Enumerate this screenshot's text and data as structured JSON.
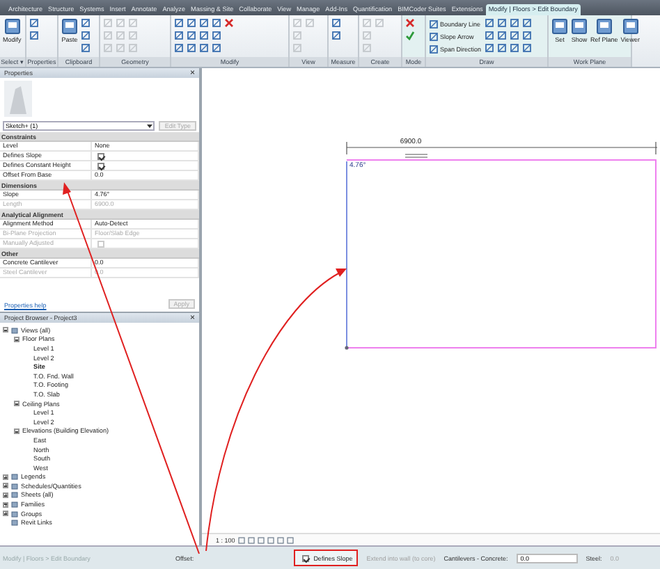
{
  "ribbon_tabs": [
    {
      "label": "Architecture",
      "selected": false
    },
    {
      "label": "Structure",
      "selected": false
    },
    {
      "label": "Systems",
      "selected": false
    },
    {
      "label": "Insert",
      "selected": false
    },
    {
      "label": "Annotate",
      "selected": false
    },
    {
      "label": "Analyze",
      "selected": false
    },
    {
      "label": "Massing & Site",
      "selected": false
    },
    {
      "label": "Collaborate",
      "selected": false
    },
    {
      "label": "View",
      "selected": false
    },
    {
      "label": "Manage",
      "selected": false
    },
    {
      "label": "Add-Ins",
      "selected": false
    },
    {
      "label": "Quantification",
      "selected": false
    },
    {
      "label": "BIMCoder Suites",
      "selected": false
    },
    {
      "label": "Extensions",
      "selected": false
    },
    {
      "label": "Modify | Floors > Edit Boundary",
      "selected": true
    }
  ],
  "ribbon_panels": [
    {
      "label": "Select ▾",
      "items": [
        {
          "kind": "large",
          "label": "Modify"
        }
      ]
    },
    {
      "label": "Properties",
      "items": [
        {
          "kind": "icon"
        },
        {
          "kind": "icon"
        }
      ]
    },
    {
      "label": "Clipboard",
      "items": [
        {
          "kind": "large",
          "label": "Paste"
        },
        {
          "kind": "icon"
        },
        {
          "kind": "icon"
        },
        {
          "kind": "icon"
        }
      ]
    },
    {
      "label": "Geometry",
      "items": [
        {
          "kind": "muted"
        },
        {
          "kind": "muted"
        },
        {
          "kind": "muted"
        },
        {
          "kind": "muted"
        },
        {
          "kind": "muted"
        },
        {
          "kind": "muted"
        },
        {
          "kind": "muted"
        },
        {
          "kind": "muted"
        },
        {
          "kind": "muted"
        }
      ]
    },
    {
      "label": "Modify",
      "items": [
        {
          "kind": "icon"
        },
        {
          "kind": "icon"
        },
        {
          "kind": "icon"
        },
        {
          "kind": "icon"
        },
        {
          "kind": "icon"
        },
        {
          "kind": "icon"
        },
        {
          "kind": "icon"
        },
        {
          "kind": "icon"
        },
        {
          "kind": "icon"
        },
        {
          "kind": "icon"
        },
        {
          "kind": "icon"
        },
        {
          "kind": "icon"
        },
        {
          "kind": "cancel"
        }
      ]
    },
    {
      "label": "View",
      "items": [
        {
          "kind": "muted"
        },
        {
          "kind": "muted"
        },
        {
          "kind": "muted"
        },
        {
          "kind": "muted"
        }
      ]
    },
    {
      "label": "Measure",
      "items": [
        {
          "kind": "icon"
        },
        {
          "kind": "icon"
        }
      ]
    },
    {
      "label": "Create",
      "items": [
        {
          "kind": "muted"
        },
        {
          "kind": "muted"
        },
        {
          "kind": "muted"
        },
        {
          "kind": "muted"
        }
      ]
    },
    {
      "label": "Mode",
      "items": [
        {
          "kind": "cancel"
        },
        {
          "kind": "finish"
        }
      ]
    },
    {
      "label": "Draw",
      "items": [
        {
          "kind": "small",
          "label": "Boundary Line"
        },
        {
          "kind": "small",
          "label": "Slope Arrow"
        },
        {
          "kind": "small",
          "label": "Span Direction"
        },
        {
          "kind": "icon"
        },
        {
          "kind": "icon"
        },
        {
          "kind": "icon"
        },
        {
          "kind": "icon"
        },
        {
          "kind": "icon"
        },
        {
          "kind": "icon"
        },
        {
          "kind": "icon"
        },
        {
          "kind": "icon"
        },
        {
          "kind": "icon"
        },
        {
          "kind": "icon"
        },
        {
          "kind": "icon"
        },
        {
          "kind": "icon"
        }
      ]
    },
    {
      "label": "Work Plane",
      "items": [
        {
          "kind": "large",
          "label": "Set"
        },
        {
          "kind": "large",
          "label": "Show"
        },
        {
          "kind": "large",
          "label": "Ref Plane"
        },
        {
          "kind": "large",
          "label": "Viewer"
        }
      ]
    }
  ],
  "properties": {
    "title": "Properties",
    "close": "×",
    "type_selector": "Sketch+ (1)",
    "edit_type": "Edit Type",
    "groups": [
      {
        "name": "Constraints",
        "rows": [
          {
            "kind": "text",
            "label": "Level",
            "value": "None",
            "disabled": false
          },
          {
            "kind": "checkbox",
            "label": "Defines Slope",
            "checked": true,
            "disabled": false
          },
          {
            "kind": "checkbox",
            "label": "Defines Constant Height",
            "checked": true,
            "disabled": false
          },
          {
            "kind": "text",
            "label": "Offset From Base",
            "value": "0.0",
            "disabled": false
          }
        ]
      },
      {
        "name": "Dimensions",
        "rows": [
          {
            "kind": "text",
            "label": "Slope",
            "value": "4.76°",
            "disabled": false
          },
          {
            "kind": "text",
            "label": "Length",
            "value": "6900.0",
            "disabled": true
          }
        ]
      },
      {
        "name": "Analytical Alignment",
        "rows": [
          {
            "kind": "text",
            "label": "Alignment Method",
            "value": "Auto-Detect",
            "disabled": false
          },
          {
            "kind": "text",
            "label": "Bi-Plane Projection",
            "value": "Floor/Slab Edge",
            "disabled": true
          },
          {
            "kind": "checkbox",
            "label": "Manually Adjusted",
            "checked": false,
            "disabled": true
          }
        ]
      },
      {
        "name": "Other",
        "rows": [
          {
            "kind": "text",
            "label": "Concrete Cantilever",
            "value": "0.0",
            "disabled": false
          },
          {
            "kind": "text",
            "label": "Steel Cantilever",
            "value": "0.0",
            "disabled": true
          }
        ]
      }
    ],
    "help_link": "Properties help",
    "apply": "Apply"
  },
  "project_browser": {
    "title": "Project Browser - Project3",
    "close": "×",
    "tree": [
      {
        "label": "Views (all)",
        "expanded": true,
        "active": false,
        "children": [
          {
            "label": "Floor Plans",
            "expanded": true,
            "active": false,
            "children": [
              {
                "label": "Level 1",
                "active": false
              },
              {
                "label": "Level 2",
                "active": false
              },
              {
                "label": "Site",
                "active": true
              },
              {
                "label": "T.O. Fnd. Wall",
                "active": false
              },
              {
                "label": "T.O. Footing",
                "active": false
              },
              {
                "label": "T.O. Slab",
                "active": false
              }
            ]
          },
          {
            "label": "Ceiling Plans",
            "expanded": true,
            "active": false,
            "children": [
              {
                "label": "Level 1",
                "active": false
              },
              {
                "label": "Level 2",
                "active": false
              }
            ]
          },
          {
            "label": "Elevations (Building Elevation)",
            "expanded": true,
            "active": false,
            "children": [
              {
                "label": "East",
                "active": false
              },
              {
                "label": "North",
                "active": false
              },
              {
                "label": "South",
                "active": false
              },
              {
                "label": "West",
                "active": false
              }
            ]
          }
        ]
      },
      {
        "label": "Legends",
        "expanded": false,
        "active": false
      },
      {
        "label": "Schedules/Quantities",
        "expanded": false,
        "active": false
      },
      {
        "label": "Sheets (all)",
        "expanded": false,
        "active": false
      },
      {
        "label": "Families",
        "expanded": false,
        "active": false
      },
      {
        "label": "Groups",
        "expanded": false,
        "active": false
      },
      {
        "label": "Revit Links",
        "active": false
      }
    ]
  },
  "canvas": {
    "dimension": "6900.0",
    "slope_label": "4.76°",
    "scale": "1 : 100"
  },
  "status_bar": {
    "mode": "Modify | Floors > Edit Boundary",
    "offset_label": "Offset:",
    "defines_slope": {
      "label": "Defines Slope",
      "checked": true
    },
    "extend": {
      "label": "Extend into wall (to core)",
      "disabled": true
    },
    "concrete": {
      "label": "Cantilevers - Concrete:",
      "value": "0.0"
    },
    "steel": {
      "label": "Steel:",
      "value": "0.0",
      "disabled": true
    }
  }
}
